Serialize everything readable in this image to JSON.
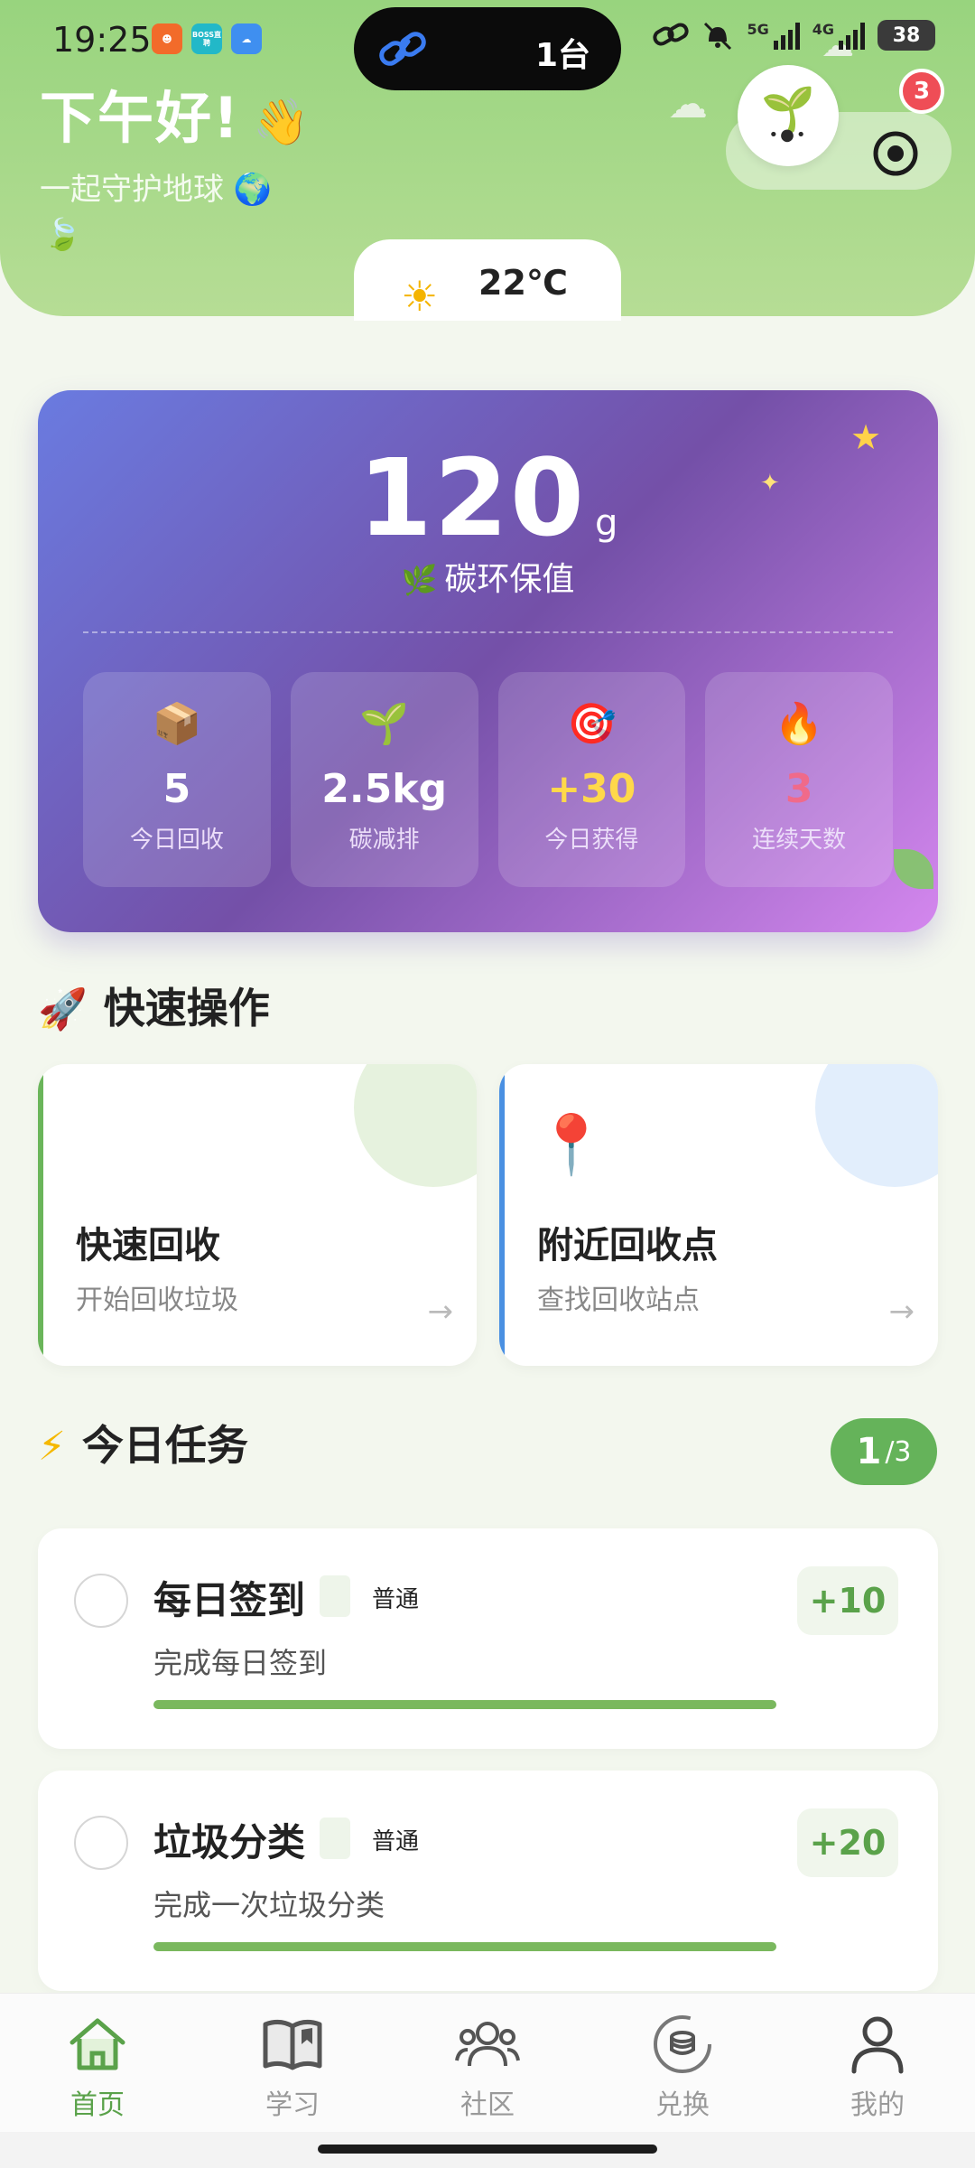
{
  "status_bar": {
    "time": "19:25",
    "island_text": "1台",
    "network_1": "5G",
    "network_2": "4G",
    "battery": "38",
    "app_icon_2_label": "BOSS直聘"
  },
  "header": {
    "greeting": "下午好!",
    "greeting_emoji": "👋",
    "subtitle": "一起守护地球 🌍",
    "notification_count": "3",
    "weather_temp": "22℃",
    "weather_icon": "sun-icon"
  },
  "carbon_card": {
    "value": "120",
    "unit": "g",
    "label": "碳环保值",
    "stats": [
      {
        "icon": "📦",
        "value": "5",
        "label": "今日回收",
        "color": "#ffffff"
      },
      {
        "icon": "🌱",
        "value": "2.5kg",
        "label": "碳减排",
        "color": "#ffffff"
      },
      {
        "icon": "🎯",
        "value": "+30",
        "label": "今日获得",
        "color": "#ffd84a"
      },
      {
        "icon": "🔥",
        "value": "3",
        "label": "连续天数",
        "color": "#f06a8a"
      }
    ]
  },
  "quick_actions": {
    "title": "快速操作",
    "title_emoji": "🚀",
    "items": [
      {
        "title": "快速回收",
        "desc": "开始回收垃圾",
        "arrow": "→",
        "accent": "#6ab55a"
      },
      {
        "title": "附近回收点",
        "desc": "查找回收站点",
        "arrow": "→",
        "accent": "#4a90e2",
        "icon": "📍"
      }
    ]
  },
  "tasks": {
    "title": "今日任务",
    "title_emoji": "⚡",
    "done": "1",
    "total": "/3",
    "items": [
      {
        "title": "每日签到",
        "level": "普通",
        "desc": "完成每日签到",
        "reward": "+10"
      },
      {
        "title": "垃圾分类",
        "level": "普通",
        "desc": "完成一次垃圾分类",
        "reward": "+20"
      }
    ]
  },
  "nav": {
    "items": [
      {
        "label": "首页",
        "icon": "home-icon",
        "active": true
      },
      {
        "label": "学习",
        "icon": "book-icon",
        "active": false
      },
      {
        "label": "社区",
        "icon": "community-icon",
        "active": false
      },
      {
        "label": "兑换",
        "icon": "exchange-icon",
        "active": false
      },
      {
        "label": "我的",
        "icon": "profile-icon",
        "active": false
      }
    ]
  },
  "colors": {
    "primary_green": "#65b35a",
    "card_gradient_start": "#6a7be0",
    "card_gradient_end": "#d487ee"
  }
}
